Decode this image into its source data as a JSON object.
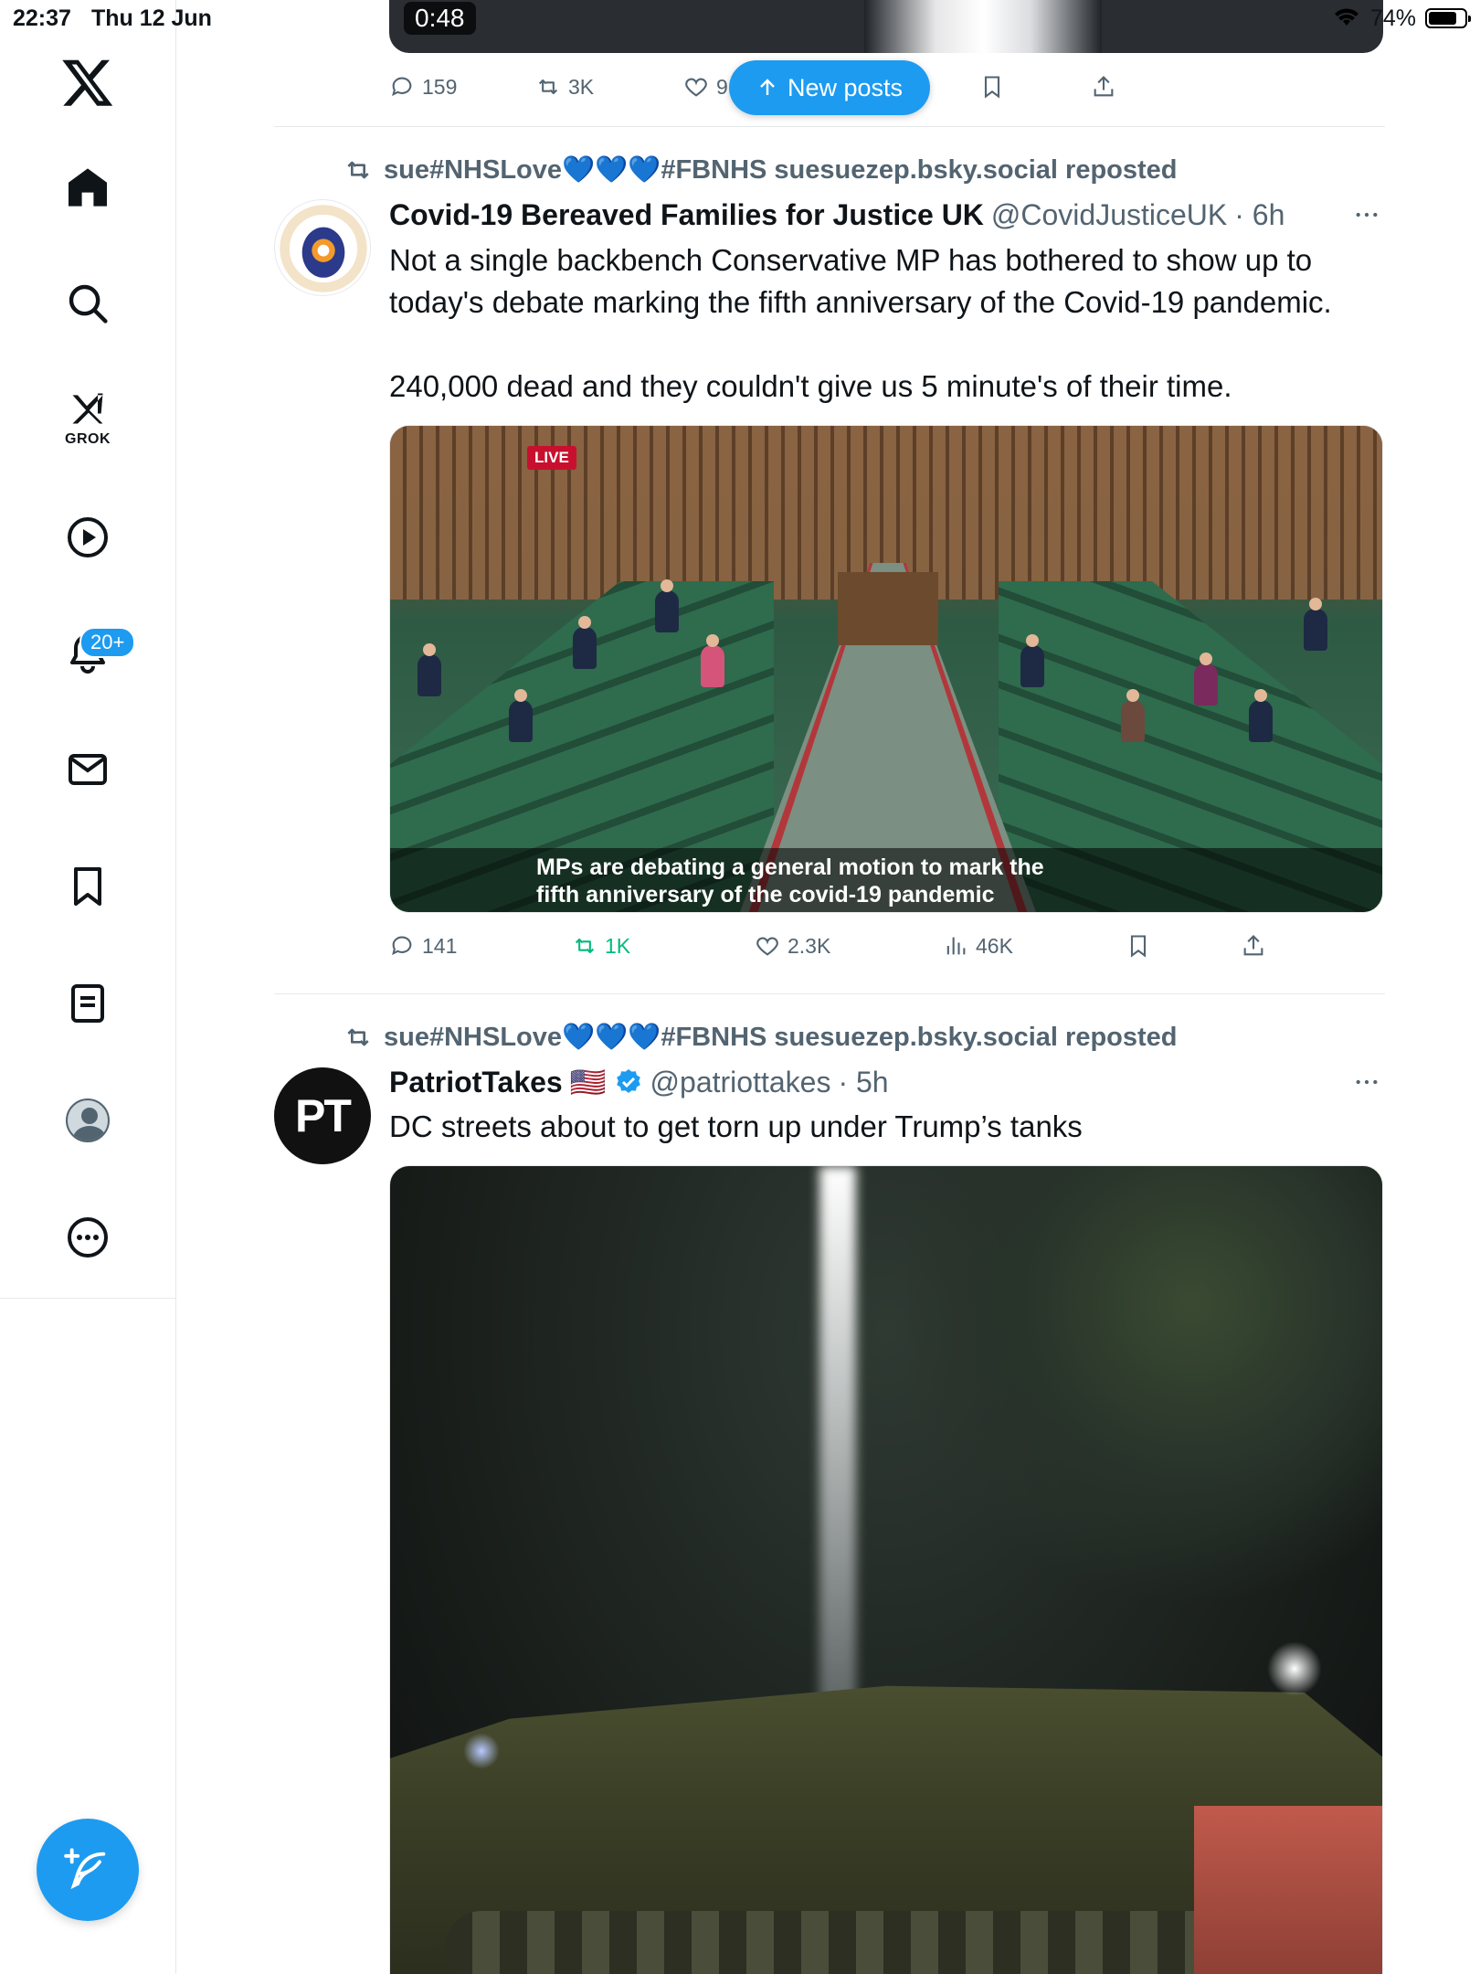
{
  "status_bar": {
    "time": "22:37",
    "date": "Thu 12 Jun",
    "battery": "74%"
  },
  "sidebar": {
    "grok_label": "GROK",
    "notifications_badge": "20+"
  },
  "top_post": {
    "video_duration": "0:48",
    "actions": {
      "replies": "159",
      "reposts": "3K",
      "likes": "9"
    }
  },
  "new_posts_label": "New posts",
  "posts": [
    {
      "repost_user": "sue#NHSLove",
      "repost_hearts": "💙💙💙",
      "repost_suffix": "#FBNHS suesuezep.bsky.social reposted",
      "name": "Covid-19 Bereaved Families for Justice UK",
      "handle": "@CovidJusticeUK",
      "time": "· 6h",
      "text": "Not a single backbench Conservative MP has bothered to show up to today's debate marking the fifth anniversary of the Covid-19 pandemic.\n\n240,000 dead and they couldn't give us 5 minute's of their time.",
      "media_live": "LIVE",
      "media_caption_line1": "MPs are debating a general motion to mark the",
      "media_caption_line2": "fifth anniversary of the covid-19 pandemic",
      "actions": {
        "replies": "141",
        "reposts": "1K",
        "likes": "2.3K",
        "views": "46K"
      }
    },
    {
      "repost_user": "sue#NHSLove",
      "repost_hearts": "💙💙💙",
      "repost_suffix": "#FBNHS suesuezep.bsky.social reposted",
      "name": "PatriotTakes",
      "flag": "🇺🇸",
      "handle": "@patriottakes",
      "time": "· 5h",
      "avatar_text": "PT",
      "text": "DC streets about to get torn up under Trump’s tanks"
    }
  ],
  "colors": {
    "accent": "#1d9bf0",
    "retweet_green": "#00ba7c",
    "secondary_text": "#536471"
  }
}
